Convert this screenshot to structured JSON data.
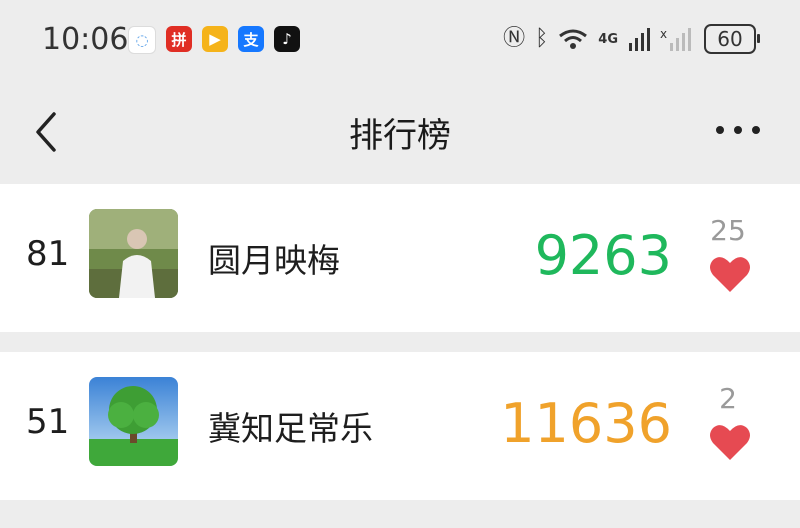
{
  "status_bar": {
    "time": "10:06",
    "app_icons": [
      {
        "name": "chat-bubble-icon",
        "glyph": "◌",
        "color": "#ffffff",
        "text_color": "#5aa0e8"
      },
      {
        "name": "pinduoduo-icon",
        "glyph": "拼",
        "color": "#e02e24",
        "text_color": "#ffffff"
      },
      {
        "name": "video-play-icon",
        "glyph": "▶",
        "color": "#f5b31a",
        "text_color": "#ffffff"
      },
      {
        "name": "alipay-icon",
        "glyph": "支",
        "color": "#1678ff",
        "text_color": "#ffffff"
      },
      {
        "name": "tiktok-icon",
        "glyph": "♪",
        "color": "#111111",
        "text_color": "#ffffff"
      }
    ],
    "network_label": "4G",
    "battery": "60"
  },
  "nav": {
    "title": "排行榜"
  },
  "rankings": [
    {
      "rank": "81",
      "name": "圆月映梅",
      "steps": "9263",
      "steps_color": "#1fb85c",
      "likes": "25"
    },
    {
      "rank": "51",
      "name": "冀知足常乐",
      "steps": "11636",
      "steps_color": "#f0a22b",
      "likes": "2"
    }
  ],
  "colors": {
    "heart": "#e64a52"
  }
}
